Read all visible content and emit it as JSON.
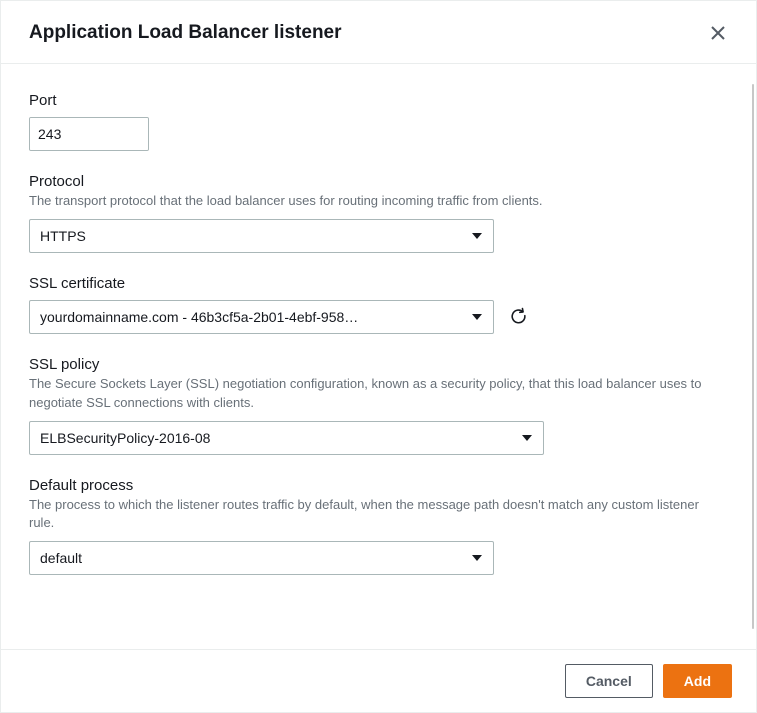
{
  "header": {
    "title": "Application Load Balancer listener"
  },
  "fields": {
    "port": {
      "label": "Port",
      "value": "243"
    },
    "protocol": {
      "label": "Protocol",
      "description": "The transport protocol that the load balancer uses for routing incoming traffic from clients.",
      "value": "HTTPS"
    },
    "ssl_certificate": {
      "label": "SSL certificate",
      "value": "yourdomainname.com - 46b3cf5a-2b01-4ebf-958…"
    },
    "ssl_policy": {
      "label": "SSL policy",
      "description": "The Secure Sockets Layer (SSL) negotiation configuration, known as a security policy, that this load balancer uses to negotiate SSL connections with clients.",
      "value": "ELBSecurityPolicy-2016-08"
    },
    "default_process": {
      "label": "Default process",
      "description": "The process to which the listener routes traffic by default, when the message path doesn't match any custom listener rule.",
      "value": "default"
    }
  },
  "footer": {
    "cancel": "Cancel",
    "add": "Add"
  }
}
